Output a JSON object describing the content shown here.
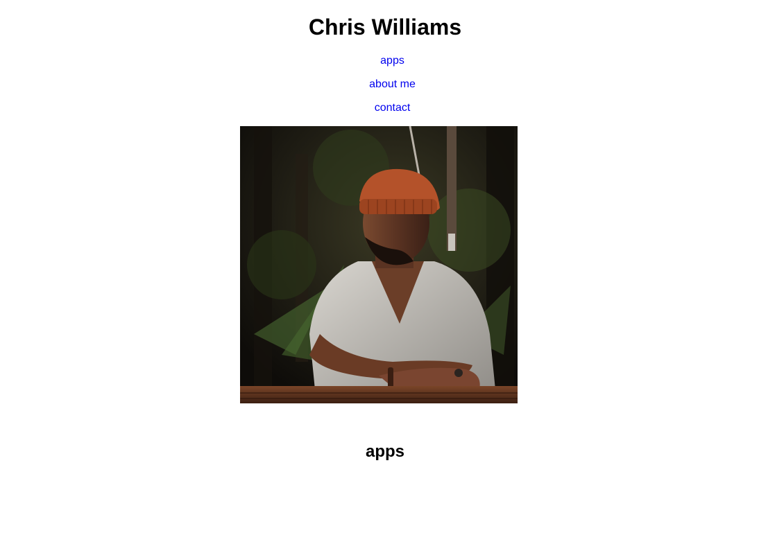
{
  "header": {
    "title": "Chris Williams"
  },
  "nav": {
    "items": [
      {
        "label": "apps"
      },
      {
        "label": "about me"
      },
      {
        "label": "contact"
      }
    ],
    "link_color": "#0000ee"
  },
  "portrait": {
    "alt": "Portrait of a man in an orange beanie and white t-shirt sitting at a wooden table outdoors"
  },
  "apps_section": {
    "heading": "apps"
  }
}
